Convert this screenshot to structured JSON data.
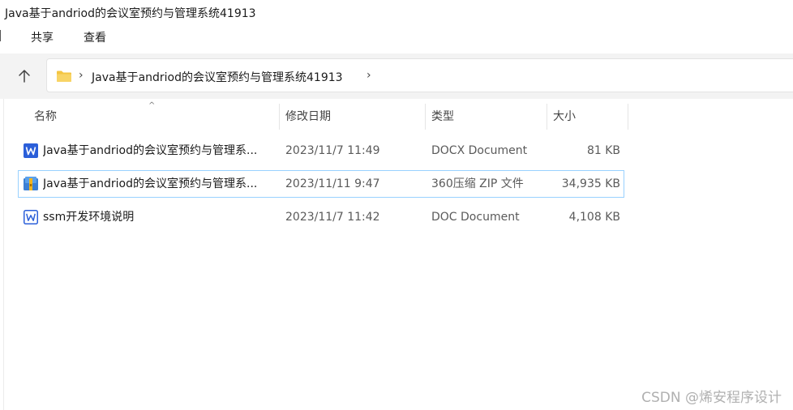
{
  "window": {
    "title": "Java基于andriod的会议室预约与管理系统41913"
  },
  "ribbon": {
    "tabs": [
      "共享",
      "查看"
    ]
  },
  "address_bar": {
    "path": "Java基于andriod的会议室预约与管理系统41913"
  },
  "columns": {
    "name": "名称",
    "date": "修改日期",
    "type": "类型",
    "size": "大小"
  },
  "files": [
    {
      "name": "Java基于andriod的会议室预约与管理系...",
      "date": "2023/11/7 11:49",
      "type": "DOCX Document",
      "size": "81 KB",
      "icon": "word-docx-icon",
      "selected": false
    },
    {
      "name": "Java基于andriod的会议室预约与管理系...",
      "date": "2023/11/11 9:47",
      "type": "360压缩 ZIP 文件",
      "size": "34,935 KB",
      "icon": "zip-archive-icon",
      "selected": true
    },
    {
      "name": "ssm开发环境说明",
      "date": "2023/11/7 11:42",
      "type": "DOC Document",
      "size": "4,108 KB",
      "icon": "word-doc-icon",
      "selected": false
    }
  ],
  "watermark": "CSDN @烯安程序设计",
  "colors": {
    "toolbar_bg": "#f3f3f3",
    "selection_border": "#99d1ff",
    "folder_yellow": "#f4c542",
    "word_blue": "#2b5fd9"
  }
}
